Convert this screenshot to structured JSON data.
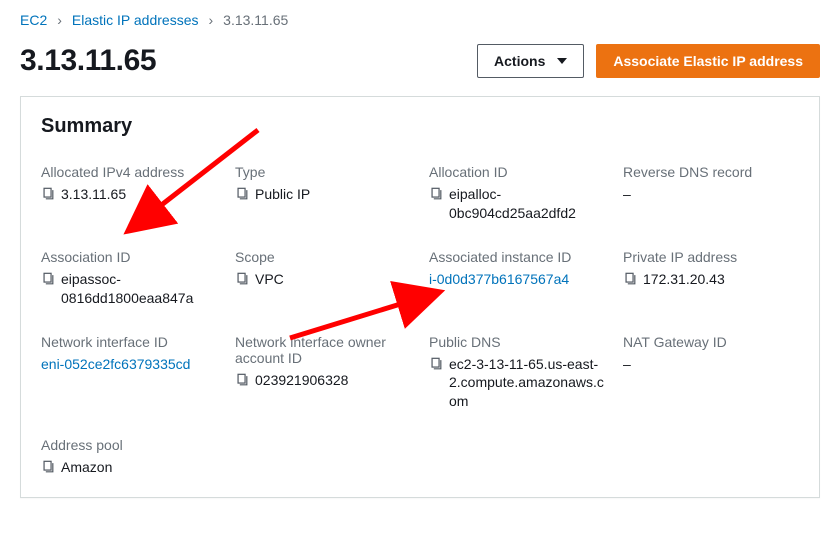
{
  "breadcrumbs": {
    "root": "EC2",
    "mid": "Elastic IP addresses",
    "current": "3.13.11.65"
  },
  "title": "3.13.11.65",
  "actions": {
    "actions_label": "Actions",
    "associate_label": "Associate Elastic IP address"
  },
  "summary": {
    "heading": "Summary",
    "fields": {
      "allocated_ipv4": {
        "label": "Allocated IPv4 address",
        "value": "3.13.11.65",
        "copy": true
      },
      "type": {
        "label": "Type",
        "value": "Public IP",
        "copy": true
      },
      "allocation_id": {
        "label": "Allocation ID",
        "value": "eipalloc-0bc904cd25aa2dfd2",
        "copy": true
      },
      "reverse_dns": {
        "label": "Reverse DNS record",
        "value": "–",
        "copy": false
      },
      "association_id": {
        "label": "Association ID",
        "value": "eipassoc-0816dd1800eaa847a",
        "copy": true
      },
      "scope": {
        "label": "Scope",
        "value": "VPC",
        "copy": true
      },
      "associated_instance_id": {
        "label": "Associated instance ID",
        "value": "i-0d0d377b6167567a4",
        "copy": false,
        "link": true
      },
      "private_ip": {
        "label": "Private IP address",
        "value": "172.31.20.43",
        "copy": true
      },
      "eni_id": {
        "label": "Network interface ID",
        "value": "eni-052ce2fc6379335cd",
        "copy": false,
        "link": true
      },
      "eni_owner": {
        "label": "Network interface owner account ID",
        "value": "023921906328",
        "copy": true
      },
      "public_dns": {
        "label": "Public DNS",
        "value": "ec2-3-13-11-65.us-east-2.compute.amazonaws.com",
        "copy": true
      },
      "nat_gateway": {
        "label": "NAT Gateway ID",
        "value": "–",
        "copy": false
      },
      "address_pool": {
        "label": "Address pool",
        "value": "Amazon",
        "copy": true
      }
    }
  }
}
